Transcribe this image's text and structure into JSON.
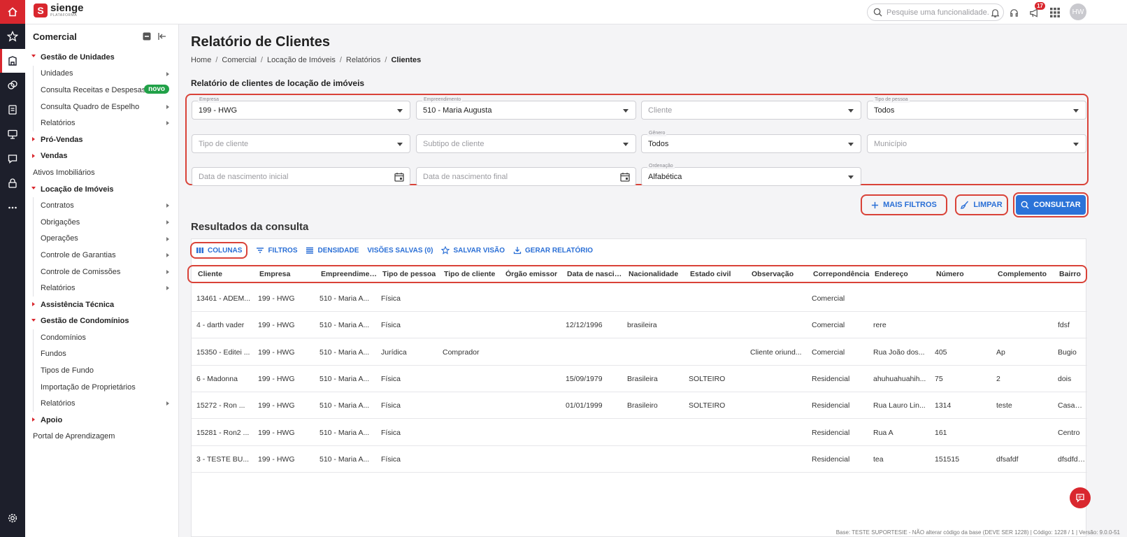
{
  "app": {
    "logo_name": "sienge",
    "logo_sub": "PLATAFORMA",
    "logo_letter": "S"
  },
  "topbar": {
    "search_placeholder": "Pesquise uma funcionalidade.",
    "notifications_badge": "17",
    "avatar_initials": "HW"
  },
  "rail": {
    "icons": [
      "home-icon",
      "star-icon",
      "building-icon",
      "money-icon",
      "document-icon",
      "presentation-icon",
      "chat-icon",
      "lock-icon",
      "more-icon",
      "settings-icon"
    ]
  },
  "sidebar": {
    "title": "Comercial",
    "items": [
      {
        "label": "Gestão de Unidades",
        "type": "group",
        "open": true
      },
      {
        "label": "Unidades",
        "type": "sub",
        "arrow": true
      },
      {
        "label": "Consulta Receitas e Despesas",
        "type": "sub",
        "badge": "novo"
      },
      {
        "label": "Consulta Quadro de Espelho",
        "type": "sub",
        "arrow": true
      },
      {
        "label": "Relatórios",
        "type": "sub",
        "arrow": true
      },
      {
        "label": "Pró-Vendas",
        "type": "group",
        "open": false
      },
      {
        "label": "Vendas",
        "type": "group",
        "open": false
      },
      {
        "label": "Ativos Imobiliários",
        "type": "plain"
      },
      {
        "label": "Locação de Imóveis",
        "type": "group",
        "open": true
      },
      {
        "label": "Contratos",
        "type": "sub",
        "arrow": true
      },
      {
        "label": "Obrigações",
        "type": "sub",
        "arrow": true
      },
      {
        "label": "Operações",
        "type": "sub",
        "arrow": true
      },
      {
        "label": "Controle de Garantias",
        "type": "sub",
        "arrow": true
      },
      {
        "label": "Controle de Comissões",
        "type": "sub",
        "arrow": true
      },
      {
        "label": "Relatórios",
        "type": "sub",
        "arrow": true
      },
      {
        "label": "Assistência Técnica",
        "type": "group",
        "open": false
      },
      {
        "label": "Gestão de Condomínios",
        "type": "group",
        "open": true
      },
      {
        "label": "Condomínios",
        "type": "sub"
      },
      {
        "label": "Fundos",
        "type": "sub"
      },
      {
        "label": "Tipos de Fundo",
        "type": "sub"
      },
      {
        "label": "Importação de Proprietários",
        "type": "sub"
      },
      {
        "label": "Relatórios",
        "type": "sub",
        "arrow": true
      },
      {
        "label": "Apoio",
        "type": "group",
        "open": false
      },
      {
        "label": "Portal de Aprendizagem",
        "type": "plain"
      }
    ]
  },
  "main": {
    "title": "Relatório de Clientes",
    "breadcrumb": [
      "Home",
      "Comercial",
      "Locação de Imóveis",
      "Relatórios",
      "Clientes"
    ],
    "section_title": "Relatório de clientes de locação de imóveis",
    "filters": {
      "empresa": {
        "label": "Empresa",
        "value": "199 - HWG"
      },
      "empreendimento": {
        "label": "Empreendimento",
        "value": "510 - Maria Augusta"
      },
      "cliente": {
        "placeholder": "Cliente"
      },
      "tipo_pessoa": {
        "label": "Tipo de pessoa",
        "value": "Todos"
      },
      "tipo_cliente": {
        "placeholder": "Tipo de cliente"
      },
      "subtipo_cliente": {
        "placeholder": "Subtipo de cliente"
      },
      "genero": {
        "label": "Gênero",
        "value": "Todos"
      },
      "municipio": {
        "placeholder": "Município"
      },
      "data_inicial": {
        "placeholder": "Data de nascimento inicial"
      },
      "data_final": {
        "placeholder": "Data de nascimento final"
      },
      "ordenacao": {
        "label": "Ordenação",
        "value": "Alfabética"
      }
    },
    "buttons": {
      "mais_filtros": "MAIS FILTROS",
      "limpar": "LIMPAR",
      "consultar": "CONSULTAR"
    },
    "results_title": "Resultados da consulta",
    "toolbar": {
      "colunas": "COLUNAS",
      "filtros": "FILTROS",
      "densidade": "DENSIDADE",
      "visoes_salvas": "VISÕES SALVAS (0)",
      "salvar_visao": "SALVAR VISÃO",
      "gerar_relatorio": "GERAR RELATÓRIO"
    },
    "columns": [
      "Cliente",
      "Empresa",
      "Empreendimento",
      "Tipo de pessoa",
      "Tipo de cliente",
      "Órgão emissor",
      "Data de nascim...",
      "Nacionalidade",
      "Estado civil",
      "Observação",
      "Correpondência",
      "Endereço",
      "Número",
      "Complemento",
      "Bairro"
    ],
    "rows": [
      [
        "13461 - ADEM...",
        "199 - HWG",
        "510 - Maria A...",
        "Física",
        "",
        "",
        "",
        "",
        "",
        "",
        "Comercial",
        "",
        "",
        "",
        ""
      ],
      [
        "4 - darth vader",
        "199 - HWG",
        "510 - Maria A...",
        "Física",
        "",
        "",
        "12/12/1996",
        "brasileira",
        "",
        "",
        "Comercial",
        "rere",
        "",
        "",
        "fdsf"
      ],
      [
        "15350 - Editei ...",
        "199 - HWG",
        "510 - Maria A...",
        "Jurídica",
        "Comprador",
        "",
        "",
        "",
        "",
        "Cliente oriund...",
        "Comercial",
        "Rua João dos...",
        "405",
        "Ap",
        "Bugio"
      ],
      [
        "6 - Madonna",
        "199 - HWG",
        "510 - Maria A...",
        "Física",
        "",
        "",
        "15/09/1979",
        "Brasileira",
        "SOLTEIRO",
        "",
        "Residencial",
        "ahuhuahuahih...",
        "75",
        "2",
        "dois"
      ],
      [
        "15272 - Ron ...",
        "199 - HWG",
        "510 - Maria A...",
        "Física",
        "",
        "",
        "01/01/1999",
        "Brasileiro",
        "SOLTEIRO",
        "",
        "Residencial",
        "Rua Lauro Lin...",
        "1314",
        "teste",
        "CasaGrande"
      ],
      [
        "15281 - Ron2 ...",
        "199 - HWG",
        "510 - Maria A...",
        "Física",
        "",
        "",
        "",
        "",
        "",
        "",
        "Residencial",
        "Rua A",
        "161",
        "",
        "Centro"
      ],
      [
        "3 - TESTE BU...",
        "199 - HWG",
        "510 - Maria A...",
        "Física",
        "",
        "",
        "",
        "",
        "",
        "",
        "Residencial",
        "tea",
        "151515",
        "dfsafdf",
        "dfsdfdsfs"
      ]
    ],
    "footer": "Base: TESTE SUPORTESIE - NÃO alterar código da base (DEVE SER 1228) | Código: 1228 / 1 | Versão: 9.0.0-51"
  }
}
